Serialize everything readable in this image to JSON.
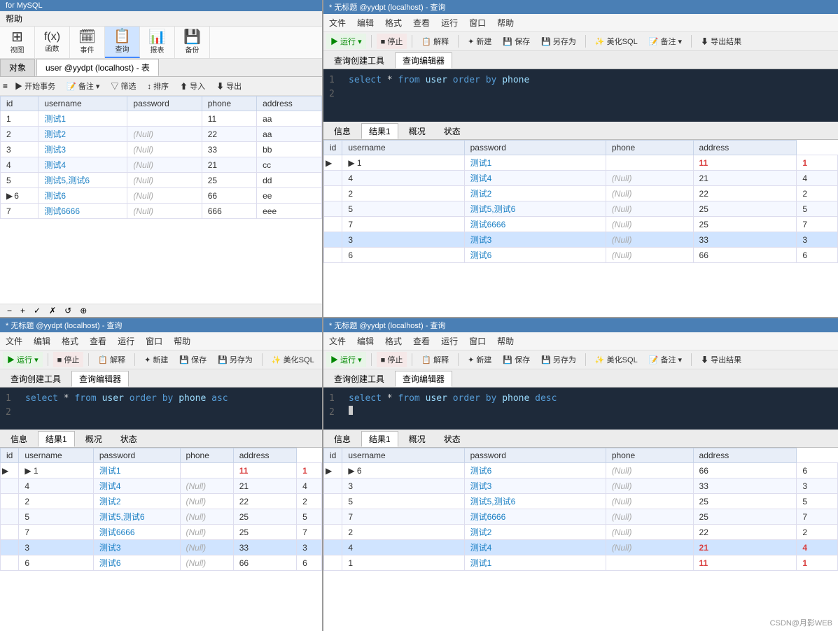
{
  "app": {
    "title": "for MySQL",
    "help_label": "帮助"
  },
  "icons": {
    "view": "视图",
    "function": "函数",
    "event": "事件",
    "query": "查询",
    "report": "报表",
    "backup": "备份"
  },
  "panel_tl": {
    "title": "user @yydpt (localhost) - 表",
    "object_label": "对象",
    "help_label": "帮助",
    "action_bar": [
      "开始事务",
      "备注",
      "筛选",
      "排序",
      "导入",
      "导出"
    ],
    "columns": [
      "id",
      "username",
      "password",
      "phone",
      "address"
    ],
    "rows": [
      {
        "id": "1",
        "username": "测试1",
        "password": "",
        "phone": "11",
        "address": "aa"
      },
      {
        "id": "2",
        "username": "测试2",
        "password": "(Null)",
        "phone": "22",
        "address": "aa"
      },
      {
        "id": "3",
        "username": "测试3",
        "password": "(Null)",
        "phone": "33",
        "address": "bb"
      },
      {
        "id": "4",
        "username": "测试4",
        "password": "(Null)",
        "phone": "21",
        "address": "cc"
      },
      {
        "id": "5",
        "username": "测试5,测试6",
        "password": "(Null)",
        "phone": "25",
        "address": "dd"
      },
      {
        "id": "6",
        "username": "测试6",
        "password": "(Null)",
        "phone": "66",
        "address": "ee",
        "cursor": true
      },
      {
        "id": "7",
        "username": "测试6666",
        "password": "(Null)",
        "phone": "666",
        "address": "eee"
      }
    ]
  },
  "panel_tr": {
    "title": "* 无标题 @yydpt (localhost) - 查询",
    "menu": [
      "文件",
      "编辑",
      "格式",
      "查看",
      "运行",
      "窗口",
      "帮助"
    ],
    "toolbar_btns": [
      "运行",
      "停止",
      "解释",
      "新建",
      "保存",
      "另存为",
      "美化SQL",
      "备注",
      "导出结果"
    ],
    "tabs": [
      "查询创建工具",
      "查询编辑器"
    ],
    "active_tab": "查询编辑器",
    "sql_lines": [
      "select * from user order by phone",
      ""
    ],
    "result_tabs": [
      "信息",
      "结果1",
      "概况",
      "状态"
    ],
    "active_result_tab": "结果1",
    "columns": [
      "id",
      "username",
      "password",
      "phone",
      "address"
    ],
    "rows": [
      {
        "id": "1",
        "username": "测试1",
        "password": "",
        "phone": "11",
        "address": "1",
        "cursor": true,
        "highlight_phone": true,
        "highlight_addr": true
      },
      {
        "id": "4",
        "username": "测试4",
        "password": "(Null)",
        "phone": "21",
        "address": "4"
      },
      {
        "id": "2",
        "username": "测试2",
        "password": "(Null)",
        "phone": "22",
        "address": "2"
      },
      {
        "id": "5",
        "username": "测试5,测试6",
        "password": "(Null)",
        "phone": "25",
        "address": "5"
      },
      {
        "id": "7",
        "username": "测试6666",
        "password": "(Null)",
        "phone": "25",
        "address": "7"
      },
      {
        "id": "3",
        "username": "测试3",
        "password": "(Null)",
        "phone": "33",
        "address": "3",
        "selected": true
      },
      {
        "id": "6",
        "username": "测试6",
        "password": "(Null)",
        "phone": "66",
        "address": "6"
      }
    ]
  },
  "panel_bl": {
    "title": "* 无标题 @yydpt (localhost) - 查询",
    "menu": [
      "文件",
      "编辑",
      "格式",
      "查看",
      "运行",
      "窗口",
      "帮助"
    ],
    "toolbar_btns": [
      "运行",
      "停止",
      "解释",
      "新建",
      "保存",
      "另存为",
      "美化SQL"
    ],
    "tabs": [
      "查询创建工具",
      "查询编辑器"
    ],
    "active_tab": "查询编辑器",
    "sql_lines": [
      "select * from user order by phone asc",
      ""
    ],
    "result_tabs": [
      "信息",
      "结果1",
      "概况",
      "状态"
    ],
    "active_result_tab": "结果1",
    "columns": [
      "id",
      "username",
      "password",
      "phone",
      "address"
    ],
    "rows": [
      {
        "id": "1",
        "username": "测试1",
        "password": "",
        "phone": "11",
        "address": "1",
        "cursor": true,
        "highlight_phone": true,
        "highlight_addr": true
      },
      {
        "id": "4",
        "username": "测试4",
        "password": "(Null)",
        "phone": "21",
        "address": "4"
      },
      {
        "id": "2",
        "username": "测试2",
        "password": "(Null)",
        "phone": "22",
        "address": "2"
      },
      {
        "id": "5",
        "username": "测试5,测试6",
        "password": "(Null)",
        "phone": "25",
        "address": "5"
      },
      {
        "id": "7",
        "username": "测试6666",
        "password": "(Null)",
        "phone": "25",
        "address": "7"
      },
      {
        "id": "3",
        "username": "测试3",
        "password": "(Null)",
        "phone": "33",
        "address": "3",
        "selected": true
      },
      {
        "id": "6",
        "username": "测试6",
        "password": "(Null)",
        "phone": "66",
        "address": "6"
      }
    ]
  },
  "panel_br": {
    "title": "* 无标题 @yydpt (localhost) - 查询",
    "menu": [
      "文件",
      "编辑",
      "格式",
      "查看",
      "运行",
      "窗口",
      "帮助"
    ],
    "toolbar_btns": [
      "运行",
      "停止",
      "解释",
      "新建",
      "保存",
      "另存为",
      "美化SQL",
      "备注",
      "导出结果"
    ],
    "tabs": [
      "查询创建工具",
      "查询编辑器"
    ],
    "active_tab": "查询编辑器",
    "sql_lines": [
      "select * from user order by phone desc",
      ""
    ],
    "result_tabs": [
      "信息",
      "结果1",
      "概况",
      "状态"
    ],
    "active_result_tab": "结果1",
    "columns": [
      "id",
      "username",
      "password",
      "phone",
      "address"
    ],
    "rows": [
      {
        "id": "6",
        "username": "测试6",
        "password": "(Null)",
        "phone": "66",
        "address": "6",
        "cursor": true
      },
      {
        "id": "3",
        "username": "测试3",
        "password": "(Null)",
        "phone": "33",
        "address": "3"
      },
      {
        "id": "5",
        "username": "测试5,测试6",
        "password": "(Null)",
        "phone": "25",
        "address": "5"
      },
      {
        "id": "7",
        "username": "测试6666",
        "password": "(Null)",
        "phone": "25",
        "address": "7"
      },
      {
        "id": "2",
        "username": "测试2",
        "password": "(Null)",
        "phone": "22",
        "address": "2"
      },
      {
        "id": "4",
        "username": "测试4",
        "password": "(Null)",
        "phone": "21",
        "address": "4",
        "selected": true,
        "highlight_phone": true,
        "highlight_addr": true
      },
      {
        "id": "1",
        "username": "测试1",
        "password": "",
        "phone": "11",
        "address": "1",
        "highlight_phone": true,
        "highlight_addr": true
      }
    ]
  },
  "bottom_tools": [
    "−",
    "+",
    "✓",
    "✗",
    "↺",
    "⊕"
  ],
  "csdn_credit": "CSDN@月影WEB"
}
